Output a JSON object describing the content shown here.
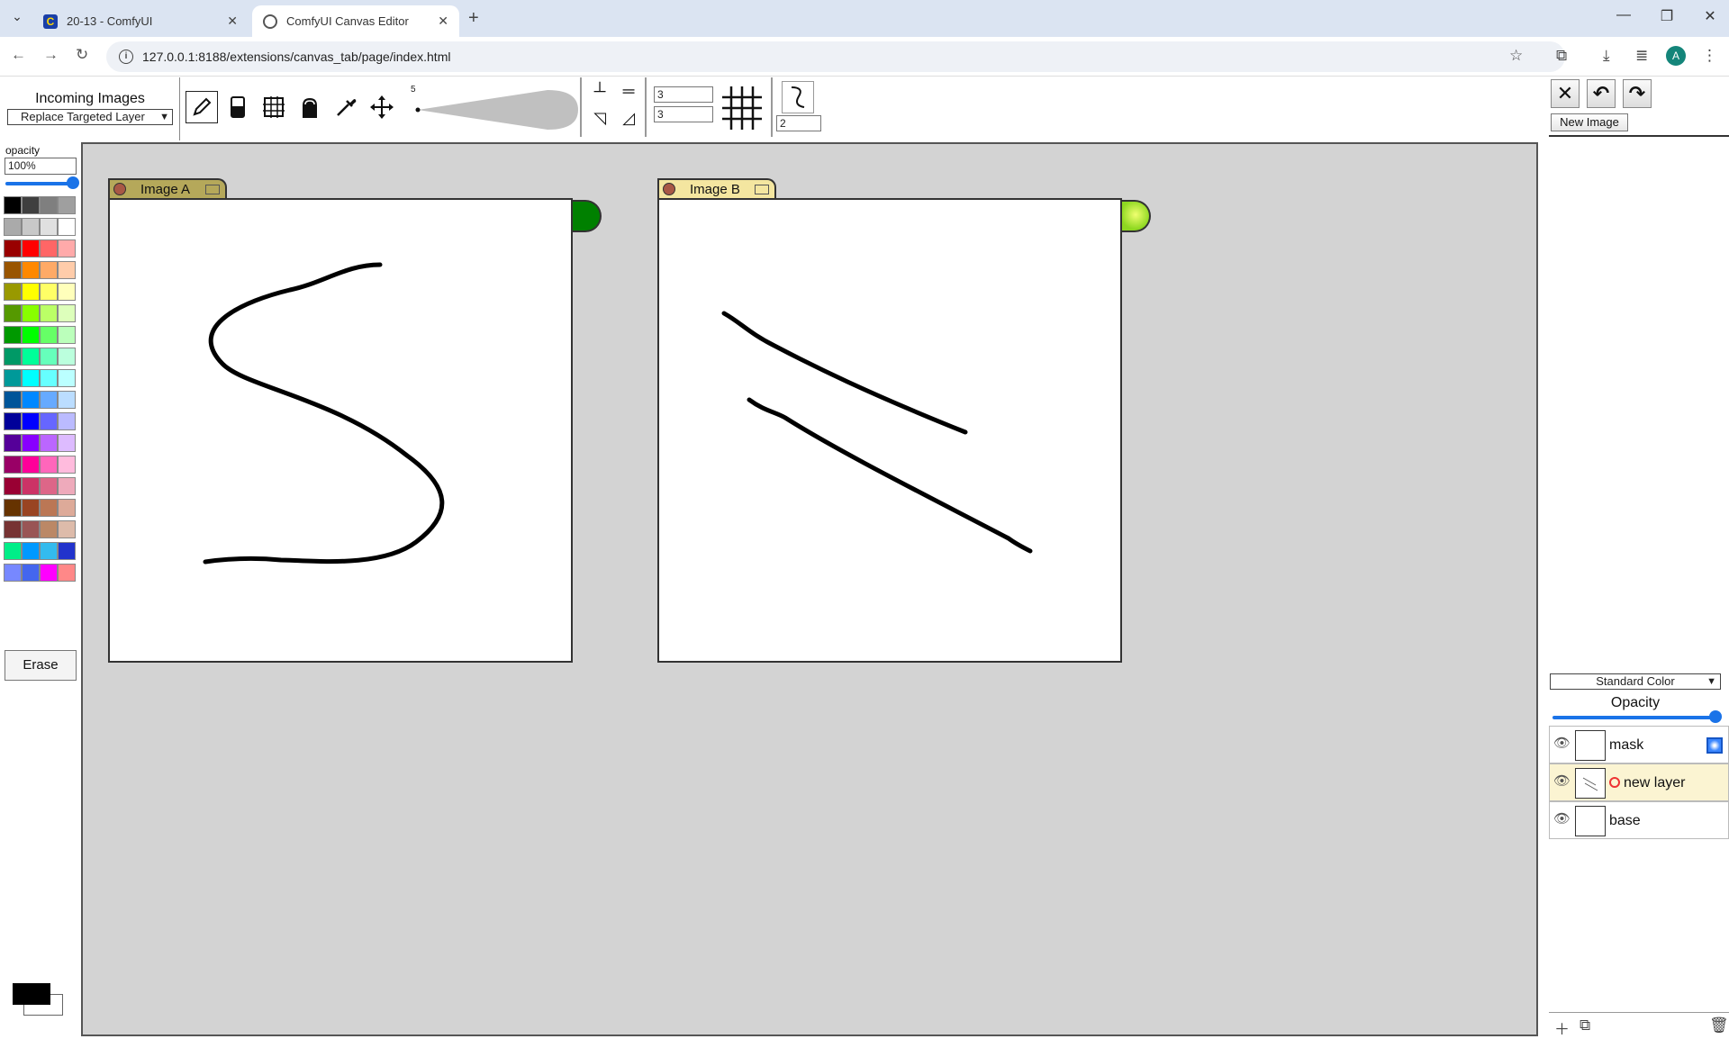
{
  "browser": {
    "tabs": [
      {
        "title": "20-13 - ComfyUI",
        "favicon": "comfyui-icon"
      },
      {
        "title": "ComfyUI Canvas Editor",
        "favicon": "globe-icon"
      }
    ],
    "url": "127.0.0.1:8188/extensions/canvas_tab/page/index.html",
    "profile_initial": "A"
  },
  "incoming": {
    "title": "Incoming Images",
    "mode": "Replace Targeted Layer"
  },
  "toolbar": {
    "tools": [
      "pencil-icon",
      "eraser-icon",
      "grid-select-icon",
      "fill-bucket-icon",
      "eyedropper-icon",
      "move-icon"
    ],
    "selected_tool": "pencil-icon",
    "brush_size": "5",
    "grid_cols": "3",
    "grid_rows": "3",
    "curve_value": "2"
  },
  "actions": {
    "new_image_label": "New Image"
  },
  "palette": {
    "opacity_label": "opacity",
    "opacity_value": "100%",
    "opacity": 1.0,
    "swatches": [
      [
        "#000000",
        "#3f3f3f",
        "#7f7f7f",
        "#9f9f9f"
      ],
      [
        "#aaaaaa",
        "#c8c8c8",
        "#e0e0e0",
        "#ffffff"
      ],
      [
        "#990000",
        "#ff0000",
        "#ff6666",
        "#ffaaaa"
      ],
      [
        "#995500",
        "#ff8800",
        "#ffaa66",
        "#ffccaa"
      ],
      [
        "#999900",
        "#ffff00",
        "#ffff66",
        "#ffffbb"
      ],
      [
        "#559900",
        "#88ff00",
        "#bbff66",
        "#ddffbb"
      ],
      [
        "#009900",
        "#00ff00",
        "#66ff66",
        "#bbffbb"
      ],
      [
        "#009966",
        "#00ff99",
        "#66ffbb",
        "#bbffdd"
      ],
      [
        "#009999",
        "#00ffff",
        "#66ffff",
        "#bbffff"
      ],
      [
        "#005599",
        "#0088ff",
        "#66aaff",
        "#bbddff"
      ],
      [
        "#000099",
        "#0000ff",
        "#6666ff",
        "#bbbbff"
      ],
      [
        "#550099",
        "#8800ff",
        "#bb66ff",
        "#ddbbff"
      ],
      [
        "#990066",
        "#ff0099",
        "#ff66bb",
        "#ffbbdd"
      ],
      [
        "#990033",
        "#cc3366",
        "#dd6688",
        "#eeaabb"
      ],
      [
        "#663300",
        "#994422",
        "#bb7755",
        "#ddaa99"
      ],
      [
        "#773333",
        "#995555",
        "#bb8866",
        "#ddbbaa"
      ],
      [
        "#00ee88",
        "#0099ff",
        "#33bbee",
        "#2233cc"
      ],
      [
        "#7788ff",
        "#4466ee",
        "#ff00ff",
        "#ff8888"
      ]
    ],
    "erase_label": "Erase",
    "foreground": "#000000",
    "background": "#ffffff"
  },
  "canvas": {
    "background": "#d3d3d3",
    "nodes": [
      {
        "title": "Image A",
        "tab_color": "#b5a85a",
        "plug_color": "#008000",
        "stroke_shape": "S-curve"
      },
      {
        "title": "Image B",
        "tab_color": "#f4e6a0",
        "plug_color": "#b7ee3c",
        "stroke_shape": "two-diagonal-lines"
      }
    ]
  },
  "layers": {
    "blend_mode": "Standard Color",
    "opacity_label": "Opacity",
    "opacity": 1.0,
    "items": [
      {
        "name": "mask",
        "visible": true,
        "active": false,
        "is_mask": true
      },
      {
        "name": "new layer",
        "visible": true,
        "active": true,
        "targeted": true
      },
      {
        "name": "base",
        "visible": true,
        "active": false
      }
    ]
  }
}
